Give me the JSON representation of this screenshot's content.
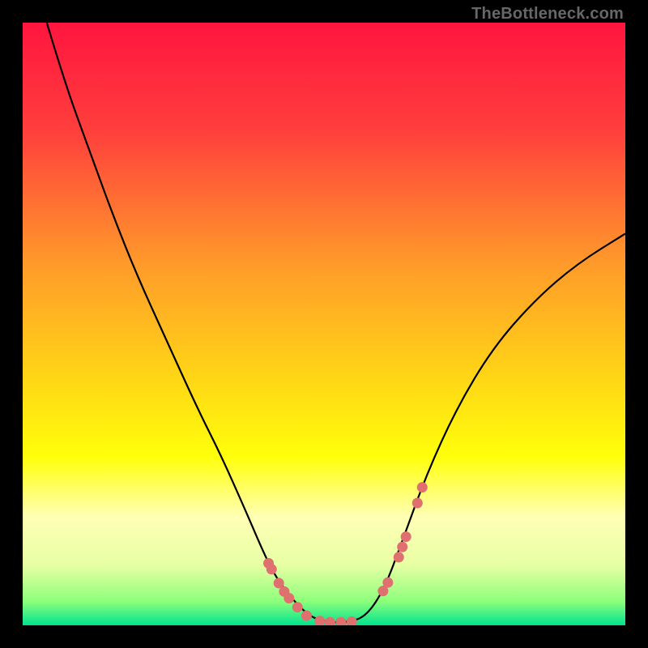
{
  "watermark": "TheBottleneck.com",
  "chart_data": {
    "type": "line",
    "title": "",
    "xlabel": "",
    "ylabel": "",
    "xlim": [
      0,
      100
    ],
    "ylim": [
      0,
      100
    ],
    "grid": false,
    "legend": false,
    "gradient_bg": {
      "stops": [
        {
          "offset": 0.0,
          "color": "#ff153e"
        },
        {
          "offset": 0.18,
          "color": "#ff3f3d"
        },
        {
          "offset": 0.4,
          "color": "#ff9a2a"
        },
        {
          "offset": 0.58,
          "color": "#ffd317"
        },
        {
          "offset": 0.72,
          "color": "#ffff0a"
        },
        {
          "offset": 0.82,
          "color": "#ffffb5"
        },
        {
          "offset": 0.9,
          "color": "#e7ffa4"
        },
        {
          "offset": 0.96,
          "color": "#8dff7b"
        },
        {
          "offset": 1.0,
          "color": "#00e38e"
        }
      ]
    },
    "series": [
      {
        "name": "bottleneck-curve",
        "color": "#000000",
        "x": [
          4,
          7,
          11,
          15,
          19,
          24,
          29,
          33,
          37,
          40,
          42,
          45,
          48,
          51,
          54,
          57,
          60,
          63,
          67,
          72,
          78,
          85,
          92,
          100
        ],
        "y": [
          100,
          90,
          79,
          68,
          58,
          47,
          36,
          28,
          19,
          12,
          8,
          4,
          1.2,
          0.5,
          0.5,
          1.5,
          6,
          14,
          25,
          36,
          46,
          54,
          60,
          65
        ]
      }
    ],
    "markers": {
      "name": "highlight-points",
      "color": "#e06f6f",
      "radius": 6.5,
      "x": [
        40.8,
        41.3,
        42.5,
        43.4,
        44.2,
        45.6,
        47.1,
        49.3,
        51.0,
        52.8,
        54.6,
        59.8,
        60.6,
        62.4,
        63.0,
        63.6,
        65.5,
        66.3
      ],
      "y": [
        10.3,
        9.3,
        7.0,
        5.6,
        4.5,
        3.0,
        1.6,
        0.7,
        0.5,
        0.5,
        0.6,
        5.7,
        7.1,
        11.3,
        13.0,
        14.7,
        20.3,
        22.9
      ]
    }
  }
}
